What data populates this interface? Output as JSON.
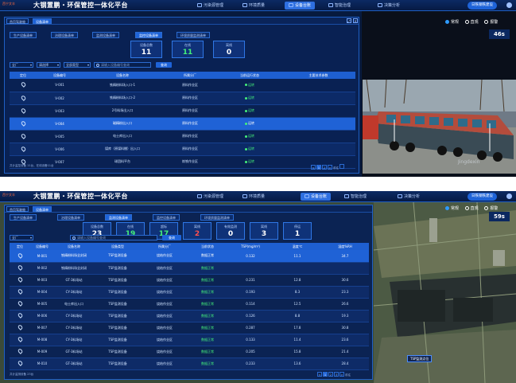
{
  "screen1": {
    "header": {
      "logo_text": "西宁文丰",
      "title": "大钢置鹏・环保管控一体化平台",
      "nav": [
        "污染源管理",
        "环境质量",
        "设备台账",
        "智能治理",
        "决策分析"
      ],
      "active_nav": "设备台账",
      "user": "日铁钢铁建设"
    },
    "panel": {
      "top_tabs": [
        "首页驾驶舱",
        "设备清单"
      ],
      "sub_tabs": [
        "生产设备清单",
        "治理设备清单",
        "监测设备清单",
        "监控设备清单",
        "环境质量监测清单"
      ],
      "active_sub_tab": "监控设备清单",
      "stats": [
        {
          "label": "设备总数",
          "value": "11",
          "color": "white"
        },
        {
          "label": "在线",
          "value": "11",
          "color": "green"
        },
        {
          "label": "离线",
          "value": "0",
          "color": "white"
        }
      ],
      "filters": [
        "全厂",
        "请选择",
        "全部类型"
      ],
      "search_placeholder": "请输入设备编号查询",
      "query_label": "查询",
      "columns": [
        "定位",
        "设备编号",
        "设备名称",
        "所属分厂",
        "当前运行状态",
        "主要技术参数"
      ],
      "rows": [
        {
          "code": "V-001",
          "name": "铁精粉料场入口-1",
          "plant": "原料作业区",
          "status": "运转"
        },
        {
          "code": "V-002",
          "name": "铁精粉料场入口-2",
          "plant": "原料作业区",
          "status": "运转"
        },
        {
          "code": "V-003",
          "name": "2号料场出入口",
          "plant": "原料作业区",
          "status": "运转"
        },
        {
          "code": "V-004",
          "name": "磁精粉出入口",
          "plant": "原料作业区",
          "status": "运转",
          "selected": true
        },
        {
          "code": "V-005",
          "name": "电士库出入口",
          "plant": "原料作业区",
          "status": "运转"
        },
        {
          "code": "V-006",
          "name": "煤库（原煤料棚）出入口",
          "plant": "原料作业区",
          "status": "运转"
        },
        {
          "code": "V-007",
          "name": "球团料平台",
          "plant": "炼铁作业区",
          "status": "运转"
        }
      ],
      "footer": "共计监控设备 11台，在线设备11台",
      "pages": [
        "1",
        "2"
      ],
      "page_prefix": "<",
      "page_suffix": ">",
      "goto": "前往"
    },
    "right": {
      "modes": [
        "常规",
        "直观",
        "报警"
      ],
      "active_mode": "常规",
      "timer": "46s",
      "watermark": "Jingdexin"
    }
  },
  "screen2": {
    "header": {
      "logo_text": "西宁文丰",
      "title": "大钢置鹏・环保管控一体化平台",
      "nav": [
        "污染源管理",
        "环境质量",
        "设备台账",
        "智能治理",
        "决策分析"
      ],
      "active_nav": "设备台账",
      "user": "日铁钢铁建设"
    },
    "panel": {
      "top_tabs": [
        "首页驾驶舱",
        "设备清单"
      ],
      "sub_tabs": [
        "生产设备清单",
        "治理设备清单",
        "监测设备清单",
        "监控设备清单",
        "环境质量监测清单"
      ],
      "active_sub_tab": "监测设备清单",
      "stats": [
        {
          "label": "设备总数",
          "value": "23",
          "color": "white"
        },
        {
          "label": "在线",
          "value": "19",
          "color": "green"
        },
        {
          "label": "超标",
          "value": "17",
          "color": "green"
        },
        {
          "label": "离线",
          "value": "2",
          "color": "red"
        },
        {
          "label": "有效监测",
          "value": "0",
          "color": "white"
        },
        {
          "label": "离线",
          "value": "3",
          "color": "white"
        },
        {
          "label": "停运",
          "value": "1",
          "color": "white"
        }
      ],
      "filters": [
        "全厂"
      ],
      "search_placeholder": "请输入设备编号查询",
      "query_label": "查询",
      "columns": [
        "定位",
        "设备编号",
        "设备名称",
        "设备类型",
        "所属分厂",
        "当前状态",
        "TSP(mg/m³)",
        "温度℃",
        "湿度%RH"
      ],
      "rows": [
        {
          "code": "M-001",
          "name": "铁精粉料场全封闭",
          "type": "TSP监测设备",
          "plant": "烧结作业区",
          "status": "数据正常",
          "tsp": "0.132",
          "temp": "11.1",
          "hum": "34.7",
          "selected": true
        },
        {
          "code": "M-002",
          "name": "铁精粉料场全封闭",
          "type": "TSP监测设备",
          "plant": "烧结作业区",
          "status": "数据正常",
          "tsp": "",
          "temp": "",
          "hum": ""
        },
        {
          "code": "M-003",
          "name": "GT-3料场站",
          "type": "TSP监测设备",
          "plant": "烧结作业区",
          "status": "数据正常",
          "tsp": "0.231",
          "temp": "12.8",
          "hum": "30.6"
        },
        {
          "code": "M-004",
          "name": "CY-3料场站",
          "type": "TSP监测设备",
          "plant": "烧结作业区",
          "status": "数据正常",
          "tsp": "0.193",
          "temp": "8.3",
          "hum": "23.3"
        },
        {
          "code": "M-005",
          "name": "电士库出入口",
          "type": "TSP监测设备",
          "plant": "烧结作业区",
          "status": "数据正常",
          "tsp": "0.114",
          "temp": "12.5",
          "hum": "26.6"
        },
        {
          "code": "M-006",
          "name": "CY-3料场站",
          "type": "TSP监测设备",
          "plant": "烧结作业区",
          "status": "数据正常",
          "tsp": "0.126",
          "temp": "8.8",
          "hum": "19.3"
        },
        {
          "code": "M-007",
          "name": "CY-3料场站",
          "type": "TSP监测设备",
          "plant": "烧结作业区",
          "status": "数据正常",
          "tsp": "0.287",
          "temp": "17.8",
          "hum": "30.8"
        },
        {
          "code": "M-008",
          "name": "CY-3料场站",
          "type": "TSP监测设备",
          "plant": "烧结作业区",
          "status": "数据正常",
          "tsp": "0.133",
          "temp": "11.4",
          "hum": "23.6"
        },
        {
          "code": "M-009",
          "name": "GT-3料场站",
          "type": "TSP监测设备",
          "plant": "烧结作业区",
          "status": "数据正常",
          "tsp": "0.205",
          "temp": "15.8",
          "hum": "21.4"
        },
        {
          "code": "M-010",
          "name": "GT-3料场站",
          "type": "TSP监测设备",
          "plant": "烧结作业区",
          "status": "数据正常",
          "tsp": "0.233",
          "temp": "13.6",
          "hum": "28.4"
        }
      ],
      "footer": "共计监测设备 23台",
      "pages": [
        "1",
        "2",
        "3"
      ],
      "page_prefix": "<",
      "page_suffix": ">",
      "goto": "前往"
    },
    "right": {
      "modes": [
        "常规",
        "直观",
        "报警"
      ],
      "active_mode": "常规",
      "timer": "59s",
      "map_tip": "TSP监测点位"
    }
  }
}
